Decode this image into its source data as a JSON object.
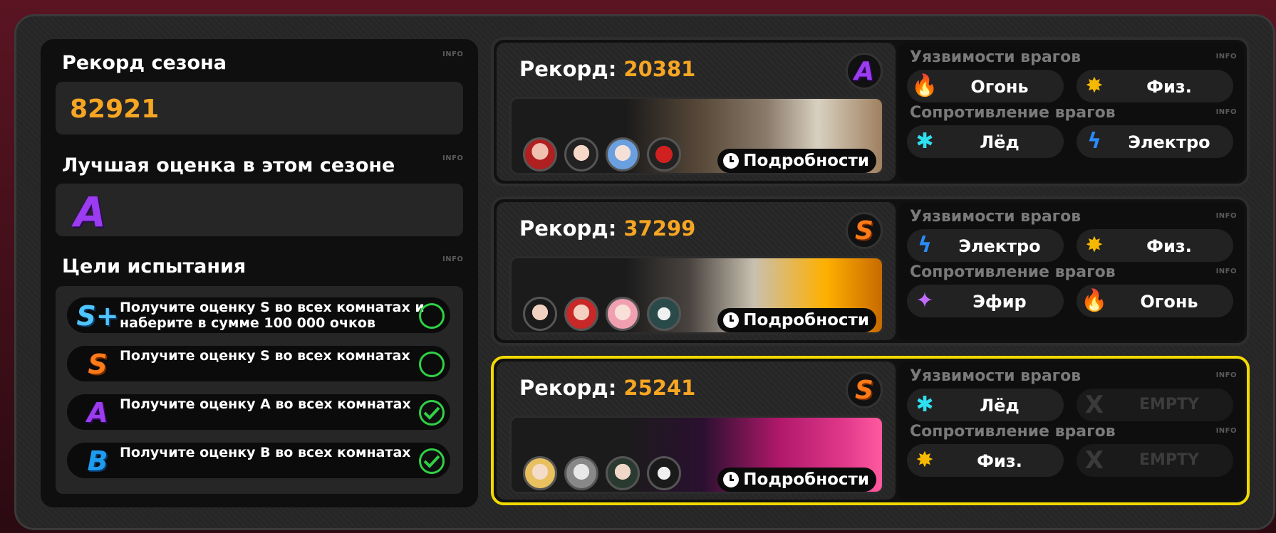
{
  "left_panel": {
    "season_record_title": "Рекорд сезона",
    "season_record_value": "82921",
    "best_grade_title": "Лучшая оценка в этом сезоне",
    "best_grade": "A",
    "goals_title": "Цели испытания",
    "info_label": "INFO",
    "goals": [
      {
        "grade": "S+",
        "text": "Получите оценку S во всех комнатах и наберите в сумме 100 000 очков",
        "completed": false
      },
      {
        "grade": "S",
        "text": "Получите оценку S во всех комнатах",
        "completed": false
      },
      {
        "grade": "A",
        "text": "Получите оценку A во всех комнатах",
        "completed": true
      },
      {
        "grade": "B",
        "text": "Получите оценку B во всех комнатах",
        "completed": true
      }
    ]
  },
  "rooms": [
    {
      "record_label": "Рекорд:",
      "record_value": "20381",
      "grade": "A",
      "selected": false,
      "details_label": "Подробности",
      "weak_title": "Уязвимости врагов",
      "resist_title": "Сопротивление врагов",
      "info_label": "INFO",
      "weaknesses": [
        {
          "icon": "fire-icon",
          "label": "Огонь"
        },
        {
          "icon": "physical-icon",
          "label": "Физ."
        }
      ],
      "resistances": [
        {
          "icon": "ice-icon",
          "label": "Лёд"
        },
        {
          "icon": "electric-icon",
          "label": "Электро"
        }
      ]
    },
    {
      "record_label": "Рекорд:",
      "record_value": "37299",
      "grade": "S",
      "selected": false,
      "details_label": "Подробности",
      "weak_title": "Уязвимости врагов",
      "resist_title": "Сопротивление врагов",
      "info_label": "INFO",
      "weaknesses": [
        {
          "icon": "electric-icon",
          "label": "Электро"
        },
        {
          "icon": "physical-icon",
          "label": "Физ."
        }
      ],
      "resistances": [
        {
          "icon": "ether-icon",
          "label": "Эфир"
        },
        {
          "icon": "fire-icon",
          "label": "Огонь"
        }
      ]
    },
    {
      "record_label": "Рекорд:",
      "record_value": "25241",
      "grade": "S",
      "selected": true,
      "details_label": "Подробности",
      "weak_title": "Уязвимости врагов",
      "resist_title": "Сопротивление врагов",
      "info_label": "INFO",
      "weaknesses": [
        {
          "icon": "ice-icon",
          "label": "Лёд"
        },
        {
          "icon": "empty-x-icon",
          "label": "EMPTY"
        }
      ],
      "resistances": [
        {
          "icon": "physical-icon",
          "label": "Физ."
        },
        {
          "icon": "empty-x-icon",
          "label": "EMPTY"
        }
      ]
    }
  ],
  "colors": {
    "accent_orange": "#f6a623",
    "selected_border": "#f2d900",
    "check_green": "#2fd145",
    "grade_a": "#9b3cf0",
    "grade_s": "#ff7a18",
    "grade_b": "#1e9cf0"
  }
}
